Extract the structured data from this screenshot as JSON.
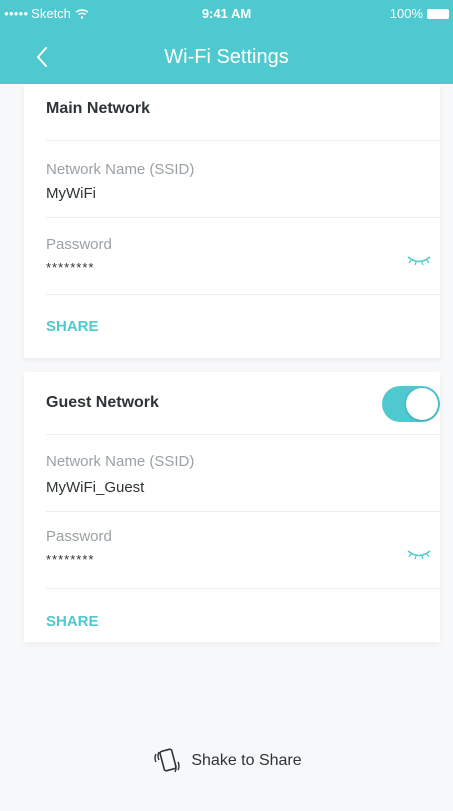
{
  "status_bar": {
    "carrier": "Sketch",
    "time": "9:41 AM",
    "battery": "100%"
  },
  "header": {
    "title": "Wi-Fi Settings",
    "back_icon": "chevron-left-icon"
  },
  "main_network": {
    "title": "Main Network",
    "ssid_label": "Network Name (SSID)",
    "ssid_value": "MyWiFi",
    "password_label": "Password",
    "password_value": "********",
    "share_label": "SHARE"
  },
  "guest_network": {
    "title": "Guest Network",
    "enabled": true,
    "ssid_label": "Network Name (SSID)",
    "ssid_value": "MyWiFi_Guest",
    "password_label": "Password",
    "password_value": "********",
    "share_label": "SHARE"
  },
  "footer": {
    "shake_label": "Shake to Share"
  },
  "colors": {
    "accent": "#4ec9cf",
    "text": "#2e3436",
    "label": "#9aa1a4",
    "background": "#f7f8f9"
  }
}
